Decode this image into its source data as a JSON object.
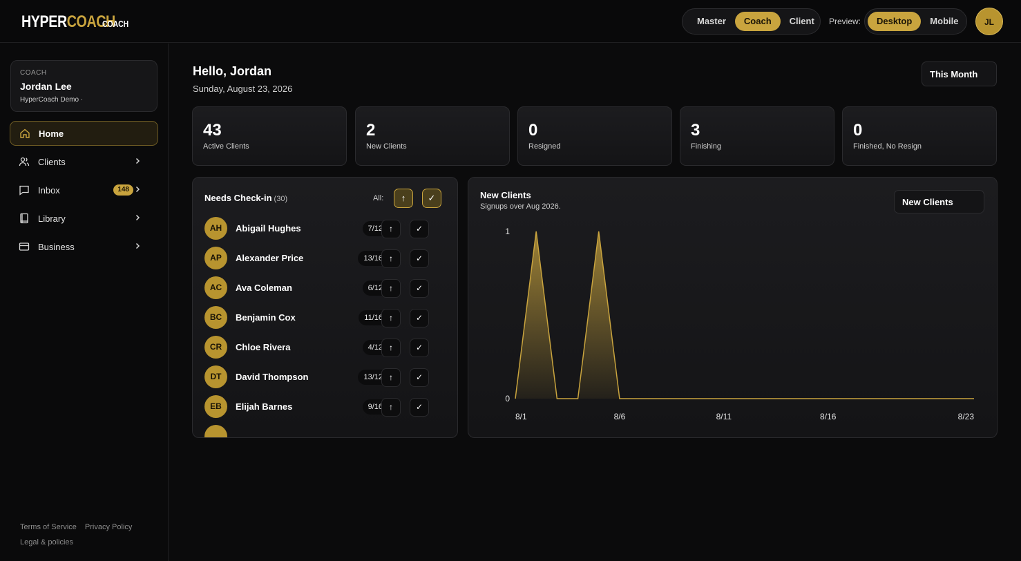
{
  "brand": {
    "name_a": "HYPER",
    "name_b": "COACH",
    "role": "COACH"
  },
  "topbar": {
    "modes": [
      "Master",
      "Coach",
      "Client"
    ],
    "active_mode": "Coach",
    "preview_label": "Preview:",
    "preview_options": [
      "Desktop",
      "Mobile"
    ],
    "active_preview": "Desktop",
    "avatar_initials": "JL"
  },
  "sidebar": {
    "coach_kicker": "COACH",
    "coach_name": "Jordan Lee",
    "coach_org": "HyperCoach Demo ·",
    "items": [
      {
        "label": "Home",
        "icon": "home-icon",
        "active": true
      },
      {
        "label": "Clients",
        "icon": "users-icon"
      },
      {
        "label": "Inbox",
        "icon": "chat-icon",
        "badge": "148"
      },
      {
        "label": "Library",
        "icon": "book-icon"
      },
      {
        "label": "Business",
        "icon": "card-icon"
      }
    ],
    "footer": {
      "terms": "Terms of Service",
      "privacy": "Privacy Policy",
      "legal": "Legal & policies"
    }
  },
  "main": {
    "greeting": "Hello, Jordan",
    "date": "Sunday, August 23, 2026",
    "period": "This Month",
    "stats": [
      {
        "value": "43",
        "label": "Active Clients"
      },
      {
        "value": "2",
        "label": "New Clients"
      },
      {
        "value": "0",
        "label": "Resigned"
      },
      {
        "value": "3",
        "label": "Finishing"
      },
      {
        "value": "0",
        "label": "Finished, No Resign"
      }
    ]
  },
  "checkin": {
    "title": "Needs Check-in",
    "count": "(30)",
    "all_label": "All:",
    "rows": [
      {
        "initials": "AH",
        "name": "Abigail Hughes",
        "progress": "7/12"
      },
      {
        "initials": "AP",
        "name": "Alexander Price",
        "progress": "13/16"
      },
      {
        "initials": "AC",
        "name": "Ava Coleman",
        "progress": "6/12"
      },
      {
        "initials": "BC",
        "name": "Benjamin Cox",
        "progress": "11/16"
      },
      {
        "initials": "CR",
        "name": "Chloe Rivera",
        "progress": "4/12"
      },
      {
        "initials": "DT",
        "name": "David Thompson",
        "progress": "13/12"
      },
      {
        "initials": "EB",
        "name": "Elijah Barnes",
        "progress": "9/16"
      }
    ]
  },
  "new_clients_panel": {
    "title": "New Clients",
    "subtitle": "Signups over Aug 2026.",
    "metric": "New Clients"
  },
  "colors": {
    "accent": "#c9a43e",
    "background": "#0b0b0c"
  },
  "chart_data": {
    "type": "area",
    "title": "New Clients",
    "subtitle": "Signups over Aug 2026.",
    "x": [
      "8/1",
      "8/2",
      "8/3",
      "8/4",
      "8/5",
      "8/6",
      "8/7",
      "8/8",
      "8/9",
      "8/10",
      "8/11",
      "8/12",
      "8/13",
      "8/14",
      "8/15",
      "8/16",
      "8/17",
      "8/18",
      "8/19",
      "8/20",
      "8/21",
      "8/22",
      "8/23"
    ],
    "y": [
      0,
      1,
      0,
      0,
      1,
      0,
      0,
      0,
      0,
      0,
      0,
      0,
      0,
      0,
      0,
      0,
      0,
      0,
      0,
      0,
      0,
      0,
      0
    ],
    "xticks": [
      "8/1",
      "8/6",
      "8/11",
      "8/16",
      "8/23"
    ],
    "yticks": [
      "0",
      "1"
    ],
    "ylim": [
      0,
      1
    ],
    "grid": false,
    "legend": "none"
  }
}
